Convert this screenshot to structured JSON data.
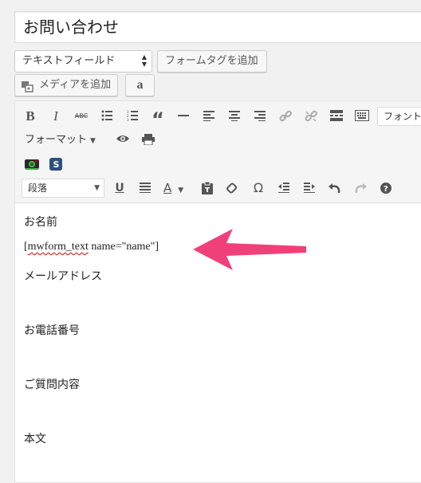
{
  "title": {
    "value": "お問い合わせ"
  },
  "form_controls": {
    "field_type": "テキストフィールド",
    "add_formtag": "フォームタグを追加",
    "add_media": "メディアを追加",
    "amazon": "a"
  },
  "toolbar": {
    "font_select": "フォント",
    "format_menu": "フォーマット",
    "paragraph": "段落",
    "icons_row1": [
      "bold-icon",
      "italic-icon",
      "strikethrough-icon",
      "bullet-list-icon",
      "numbered-list-icon",
      "blockquote-icon",
      "horizontal-rule-icon",
      "align-left-icon",
      "align-center-icon",
      "align-right-icon",
      "link-icon",
      "unlink-icon",
      "read-more-icon",
      "keyboard-icon"
    ],
    "icons_row2": [
      "preview-icon",
      "print-icon"
    ],
    "icons_row3": [
      "screenshot-plugin-icon",
      "s-plugin-icon"
    ],
    "icons_row4": [
      "underline-icon",
      "justify-icon",
      "text-color-icon",
      "paste-text-icon",
      "clear-format-icon",
      "special-char-icon",
      "outdent-icon",
      "indent-icon",
      "undo-icon",
      "redo-icon",
      "help-icon"
    ]
  },
  "content": {
    "line1": "お名前",
    "line2_prefix": "[",
    "line2_spell": "mwform_text",
    "line2_suffix": " name=\"name\"]",
    "line3": "メールアドレス",
    "line4": "お電話番号",
    "line5": "ご質問内容",
    "line6": "本文"
  },
  "colors": {
    "annotation_arrow": "#f0407a"
  }
}
